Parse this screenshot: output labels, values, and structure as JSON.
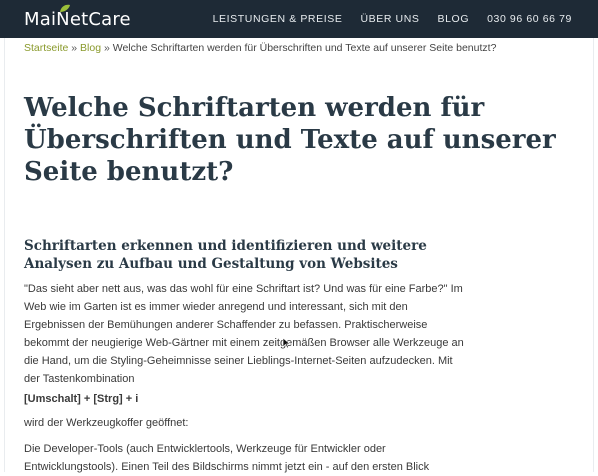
{
  "header": {
    "logo": {
      "text": "MaiNetCare",
      "leaf_color": "#9bbf3a"
    },
    "nav": [
      {
        "label": "LEISTUNGEN & PREISE"
      },
      {
        "label": "ÜBER UNS"
      },
      {
        "label": "BLOG"
      },
      {
        "label": "030 96 60 66 79"
      }
    ],
    "background": "#1e2a36"
  },
  "breadcrumb": {
    "home": "Startseite",
    "separator": "»",
    "blog": "Blog",
    "current": "Welche Schriftarten werden für Überschriften und Texte auf unserer Seite benutzt?",
    "link_color": "#8a9a2c"
  },
  "article": {
    "title": "Welche Schriftarten werden für Überschriften und Texte auf unserer Seite benutzt?",
    "subtitle": "Schriftarten erkennen und identifizieren und weitere Analysen zu Aufbau und Gestaltung von Websites",
    "paragraph_1": "\"Das sieht aber nett aus, was das wohl für eine Schriftart ist? Und was für eine Farbe?\" Im Web wie im Garten ist es immer wieder anregend und interessant, sich mit den Ergebnissen der Bemühungen anderer Schaffender zu befassen. Praktischerweise bekommt der neugierige Web-Gärtner mit einem zeitgemäßen Browser alle Werkzeuge an die Hand, um die Styling-Geheimnisse seiner Lieblings-Internet-Seiten aufzudecken. Mit der Tastenkombination",
    "shortcut": "[Umschalt] + [Strg] + i",
    "paragraph_2": "wird der Werkzeugkoffer geöffnet:",
    "paragraph_3": "Die Developer-Tools (auch Entwicklertools, Werkzeuge für Entwickler oder Entwicklungstools). Einen Teil des Bildschirms nimmt jetzt ein - auf den ersten Blick"
  }
}
